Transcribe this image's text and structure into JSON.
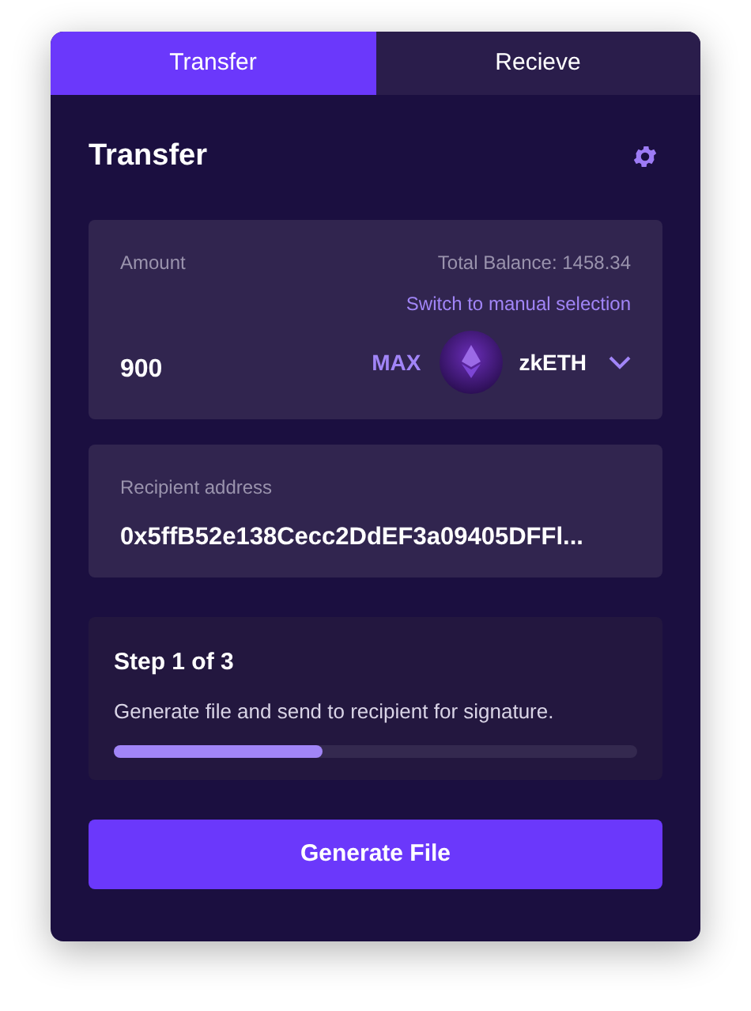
{
  "tabs": [
    {
      "label": "Transfer",
      "selected": true
    },
    {
      "label": "Recieve",
      "selected": false
    }
  ],
  "title": "Transfer",
  "amount": {
    "label": "Amount",
    "balance": "Total Balance: 1458.34",
    "switch_link": "Switch to manual selection",
    "value": "900",
    "max": "MAX",
    "token": "zkETH"
  },
  "recipient": {
    "label": "Recipient address",
    "value": "0x5ffB52e138Cecc2DdEF3a09405DFFl..."
  },
  "step": {
    "title": "Step 1 of 3",
    "description": "Generate file and send to recipient for signature.",
    "level": 0.4
  },
  "button": "Generate File"
}
